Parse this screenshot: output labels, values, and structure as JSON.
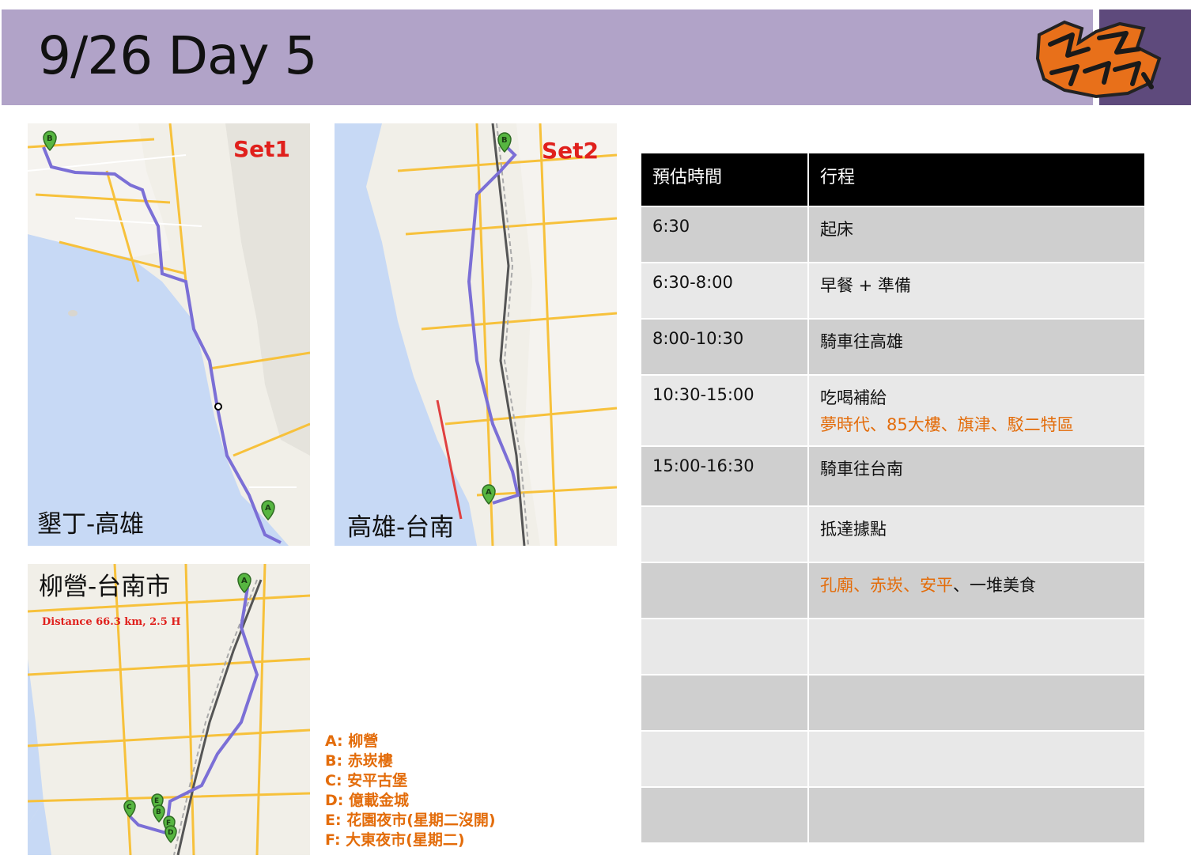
{
  "slide": {
    "title": "9/26 Day 5"
  },
  "maps": {
    "set1": {
      "set_label": "Set1",
      "route_label": "墾丁-高雄"
    },
    "set2": {
      "set_label": "Set2",
      "route_label": "高雄-台南"
    },
    "set3": {
      "route_label": "柳營-台南市",
      "distance": "Distance 66.3 km, 2.5 H"
    }
  },
  "legend": [
    "A: 柳營",
    "B: 赤崁樓",
    "C: 安平古堡",
    "D: 億載金城",
    "E: 花園夜市(星期二沒開)",
    "F: 大東夜市(星期二)"
  ],
  "schedule": {
    "headers": [
      "預估時間",
      "行程"
    ],
    "rows": [
      {
        "time": "6:30",
        "plan": "起床",
        "highlight": ""
      },
      {
        "time": "6:30-8:00",
        "plan": "早餐 + 準備",
        "highlight": ""
      },
      {
        "time": "8:00-10:30",
        "plan": "騎車往高雄",
        "highlight": ""
      },
      {
        "time": "10:30-15:00",
        "plan": "吃喝補給",
        "highlight": "夢時代、85大樓、旗津、駁二特區"
      },
      {
        "time": "15:00-16:30",
        "plan": "騎車往台南",
        "highlight": ""
      },
      {
        "time": "",
        "plan": "抵達據點",
        "highlight": ""
      },
      {
        "time": "",
        "plan": "",
        "highlight": "孔廟、赤崁、安平",
        "tail": "、一堆美食"
      },
      {
        "time": "",
        "plan": "",
        "highlight": ""
      },
      {
        "time": "",
        "plan": "",
        "highlight": ""
      },
      {
        "time": "",
        "plan": "",
        "highlight": ""
      },
      {
        "time": "",
        "plan": "",
        "highlight": ""
      }
    ]
  },
  "colors": {
    "header_bar": "#b1a3c8",
    "header_accent": "#5e4a7c",
    "highlight_text": "#e36c0a",
    "set_label": "#e0201c",
    "route_line": "#7b6fd6"
  },
  "icons": [
    "map-marker-icon",
    "logo-graffiti"
  ]
}
